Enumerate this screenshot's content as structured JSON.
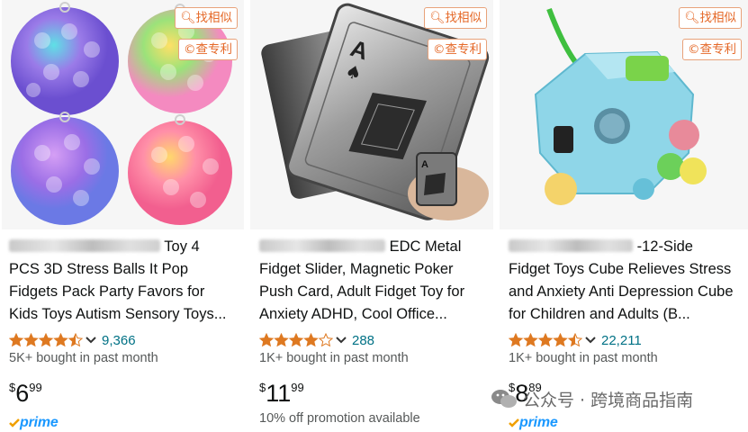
{
  "overlay": {
    "find_similar": "找相似",
    "check_patent": "查专利"
  },
  "products": [
    {
      "title_line1": "Toy 4",
      "title_rest": "PCS 3D Stress Balls It Pop Fidgets Pack Party Favors for Kids Toys Autism Sensory Toys...",
      "rating": 4.5,
      "review_count": "9,366",
      "bought": "5K+ bought in past month",
      "price": {
        "currency": "$",
        "whole": "6",
        "fraction": "99"
      },
      "badge": "prime"
    },
    {
      "title_line1": "EDC Metal",
      "title_rest": "Fidget Slider, Magnetic Poker Push Card, Adult Fidget Toy for Anxiety ADHD, Cool Office...",
      "rating": 4.0,
      "review_count": "288",
      "bought": "1K+ bought in past month",
      "price": {
        "currency": "$",
        "whole": "11",
        "fraction": "99"
      },
      "promo": "10% off promotion available"
    },
    {
      "title_line1": "-12-Side",
      "title_rest": "Fidget Toys Cube Relieves Stress and Anxiety Anti Depression Cube for Children and Adults (B...",
      "rating": 4.5,
      "review_count": "22,211",
      "bought": "1K+ bought in past month",
      "price": {
        "currency": "$",
        "whole": "8",
        "fraction": "89"
      },
      "badge": "prime"
    }
  ],
  "watermark": {
    "text": "公众号 · 跨境商品指南"
  },
  "colors": {
    "star": "#de7921",
    "link": "#007185",
    "prime": "#1a98ff",
    "overlay_border": "#e8a27a",
    "overlay_text": "#e56a2a"
  },
  "icons": [
    "search-icon",
    "patent-icon",
    "star-icon",
    "chevron-down-icon",
    "prime-check-icon",
    "wechat-icon"
  ]
}
